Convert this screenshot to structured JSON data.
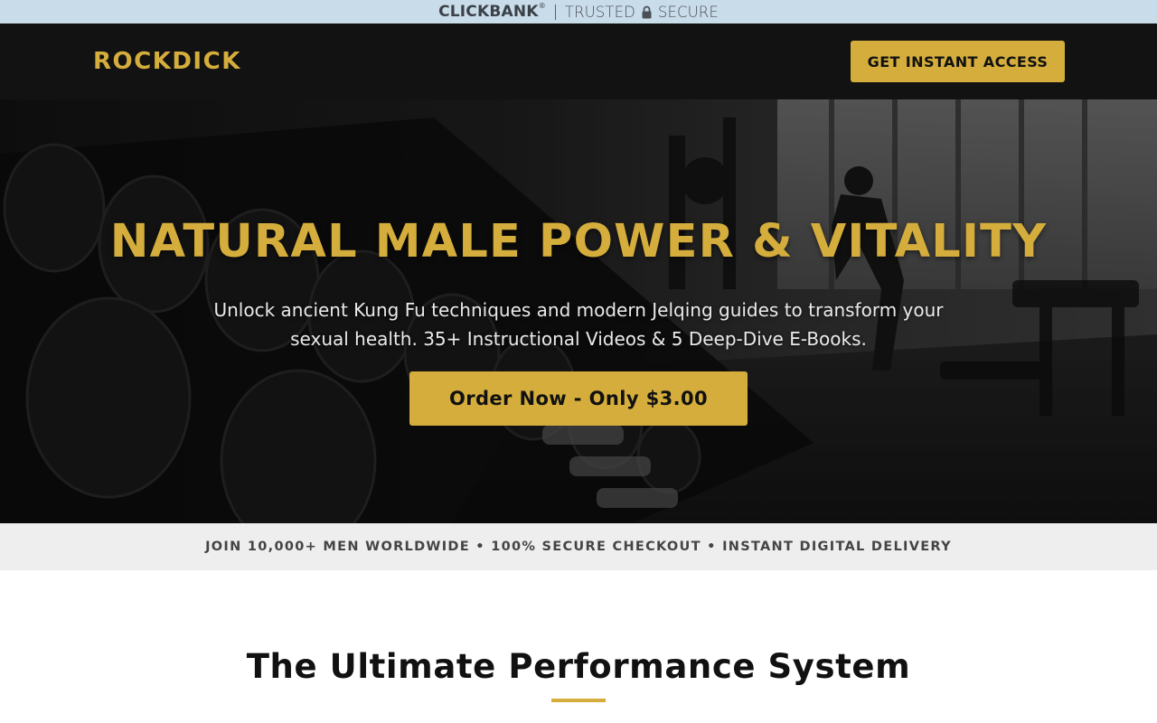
{
  "trust_bar": {
    "brand": "CLICKBANK",
    "registered_mark": "®",
    "trusted": "TRUSTED",
    "secure": "SECURE",
    "lock_icon": "lock-icon"
  },
  "header": {
    "brand": "ROCKDICK",
    "cta_label": "GET INSTANT ACCESS"
  },
  "hero": {
    "title": "NATURAL MALE POWER & VITALITY",
    "subtitle": "Unlock ancient Kung Fu techniques and modern Jelqing guides to transform your sexual health. 35+ Instructional Videos & 5 Deep-Dive E-Books.",
    "cta_label": "Order Now - Only $3.00",
    "background": "gym-dumbbell-rack-photo"
  },
  "proof_strip": {
    "text": "JOIN 10,000+ MEN WORLDWIDE • 100% SECURE CHECKOUT • INSTANT DIGITAL DELIVERY"
  },
  "section": {
    "title": "The Ultimate Performance System"
  },
  "colors": {
    "accent": "#d4ad3c",
    "header_bg": "#121212",
    "trust_bar_bg": "#c9dcea",
    "strip_bg": "#eeeeee"
  }
}
